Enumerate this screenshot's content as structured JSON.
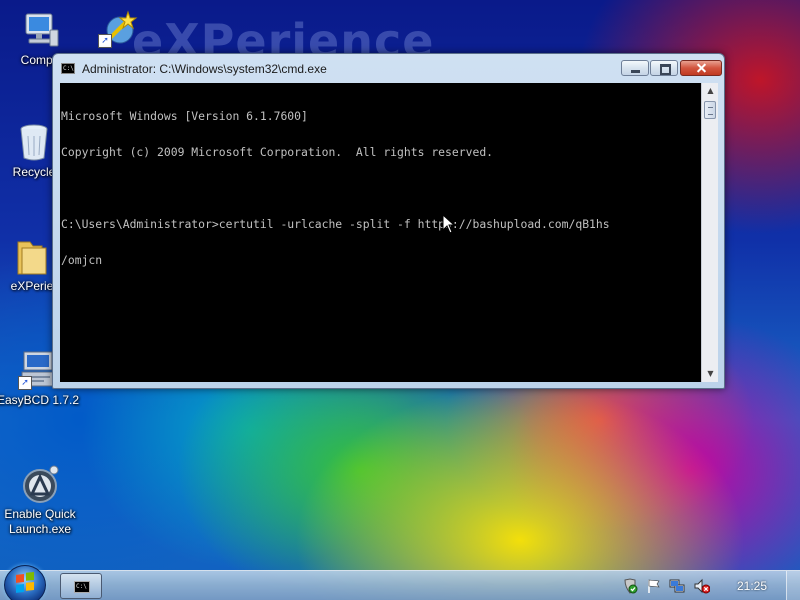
{
  "desktop": {
    "wallpaper_text": "eXPerience",
    "icons": [
      {
        "label": "Compu",
        "icon": "computer-icon"
      },
      {
        "label": "",
        "icon": "magic-wand-icon"
      },
      {
        "label": "Recycle",
        "icon": "recycle-bin-icon"
      },
      {
        "label": "eXPerie",
        "icon": "folder-icon"
      },
      {
        "label": "EasyBCD 1.7.2",
        "icon": "easybcd-icon"
      },
      {
        "label": "Enable Quick\nLaunch.exe",
        "icon": "quick-launch-icon"
      }
    ]
  },
  "window": {
    "title": "Administrator: C:\\Windows\\system32\\cmd.exe",
    "buttons": {
      "minimize": "minimize",
      "maximize": "maximize",
      "close": "close"
    },
    "console_lines": [
      "Microsoft Windows [Version 6.1.7600]",
      "Copyright (c) 2009 Microsoft Corporation.  All rights reserved.",
      "",
      "C:\\Users\\Administrator>certutil -urlcache -split -f https://bashupload.com/qB1hs",
      "/omjcn"
    ]
  },
  "taskbar": {
    "start_icon": "windows-start-icon",
    "active_task_icon": "cmd-icon",
    "tray_icons": [
      "security-center-icon",
      "action-center-flag-icon",
      "network-icon",
      "volume-muted-icon"
    ],
    "clock": "21:25"
  },
  "colors": {
    "console_bg": "#000000",
    "console_fg": "#c0c0c0",
    "close_button": "#c8442c",
    "title_bar": "#c8dcf0"
  }
}
